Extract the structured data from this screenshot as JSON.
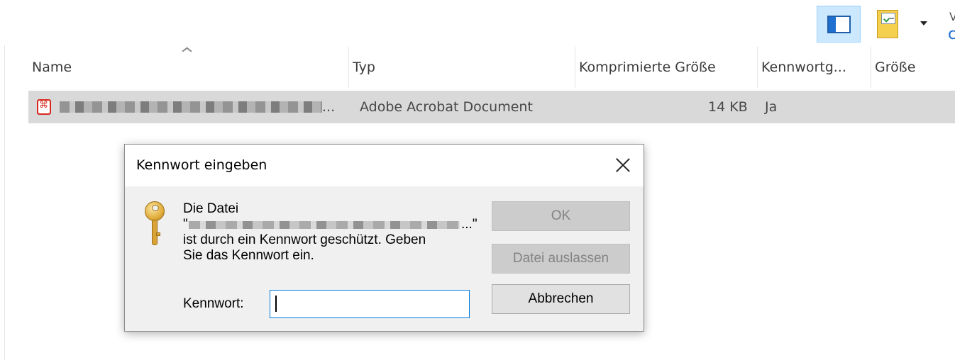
{
  "toolbar": {
    "icons": [
      "preview-pane-icon",
      "options-icon",
      "dropdown-arrow-icon"
    ],
    "edge_letter": "V",
    "edge_glyph": "c"
  },
  "columns": {
    "name": "Name",
    "type": "Typ",
    "compressed_size": "Komprimierte Größe",
    "password": "Kennwortg...",
    "size": "Größe"
  },
  "file_row": {
    "name_suffix": "...",
    "type": "Adobe Acrobat Document",
    "compressed_size": "14 KB",
    "password_protected": "Ja"
  },
  "dialog": {
    "title": "Kennwort eingeben",
    "message_line1": "Die Datei",
    "message_quote_open": "\"",
    "message_quote_close": "...\"",
    "message_line3": "ist durch ein Kennwort geschützt. Geben",
    "message_line4": "Sie das Kennwort ein.",
    "password_label": "Kennwort:",
    "password_value": "",
    "ok_label": "OK",
    "skip_label": "Datei auslassen",
    "cancel_label": "Abbrechen"
  },
  "colors": {
    "selection": "#d9d9d9",
    "accent": "#0078d7",
    "pdf_red": "#d7281e"
  }
}
